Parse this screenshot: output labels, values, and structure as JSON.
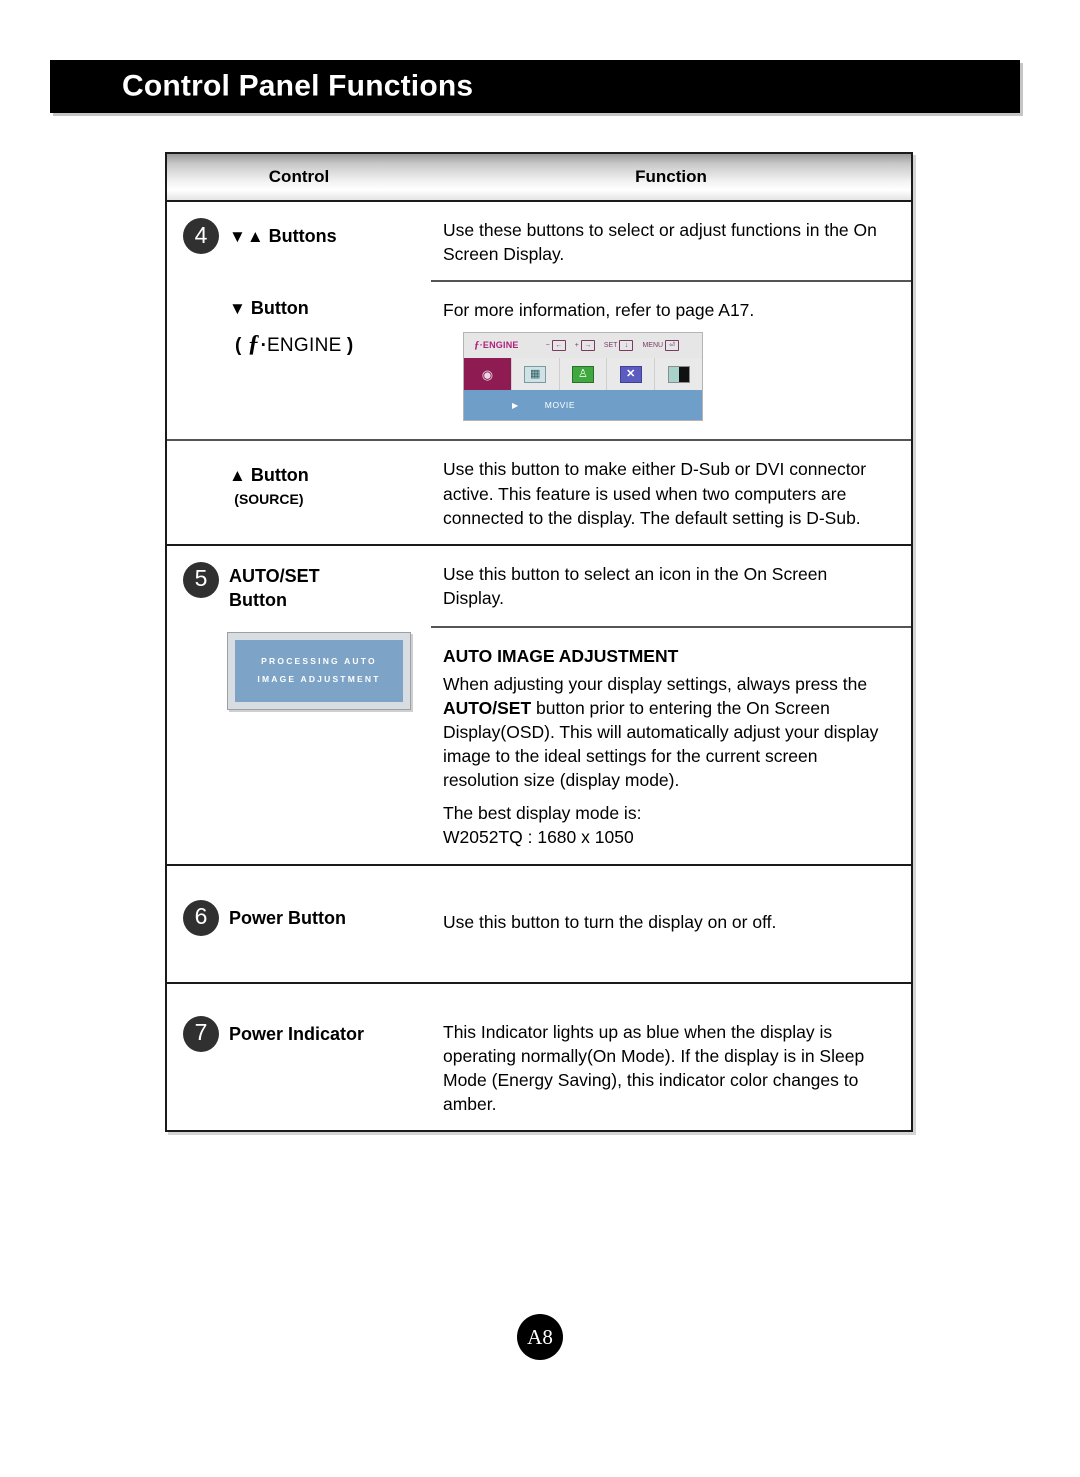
{
  "page": {
    "title": "Control Panel Functions",
    "page_number": "A8"
  },
  "table": {
    "headers": {
      "control": "Control",
      "function": "Function"
    },
    "rows": [
      {
        "number": "4",
        "blocks": [
          {
            "control_arrows": "▼▲",
            "control_label": "Buttons",
            "function_text": "Use these buttons to select or adjust functions in the On Screen Display."
          },
          {
            "control_arrows": "▼",
            "control_label": "Button",
            "control_sublabel_open": "(",
            "control_sublabel_f": "ƒ",
            "control_sublabel_dot": "·",
            "control_sublabel_name": "ENGINE",
            "control_sublabel_close": ")",
            "function_text": "For more information, refer to page A17.",
            "osd": {
              "brand_f": "ƒ",
              "brand_dot": "·",
              "brand_name": "ENGINE",
              "keys": [
                {
                  "prefix": "−",
                  "cap": "←"
                },
                {
                  "prefix": "+",
                  "cap": "→"
                },
                {
                  "prefix": "SET",
                  "cap": "↓"
                },
                {
                  "prefix": "MENU",
                  "cap": "⏎"
                }
              ],
              "icons": [
                {
                  "name": "movie-film-icon",
                  "glyph": "◉",
                  "selected": true
                },
                {
                  "name": "internet-globe-icon",
                  "glyph": "▦",
                  "selected": false
                },
                {
                  "name": "user-person-icon",
                  "glyph": "♙",
                  "selected": false
                },
                {
                  "name": "demo-x-icon",
                  "glyph": "✕",
                  "selected": false
                },
                {
                  "name": "contrast-icon",
                  "glyph": "",
                  "selected": false
                }
              ],
              "caret": "▶",
              "mode_label": "MOVIE"
            }
          },
          {
            "control_arrows": "▲",
            "control_label": "Button",
            "control_sublabel": "(SOURCE)",
            "function_text": "Use this button to make either D-Sub or DVI connector active. This feature is used when two computers are connected to the display. The default setting is D-Sub."
          }
        ]
      },
      {
        "number": "5",
        "blocks": [
          {
            "control_label_line1": "AUTO/SET",
            "control_label_line2": "Button",
            "function_text": "Use this button to select an icon in the On Screen Display."
          },
          {
            "function_title": "AUTO IMAGE ADJUSTMENT",
            "function_para1_a": "When adjusting your display settings, always press the ",
            "function_para1_bold": "AUTO/SET",
            "function_para1_b": " button prior to entering the On Screen Display(OSD). This will automatically adjust your display image to the ideal settings for the current screen resolution size (display mode).",
            "function_para2_line1": "The best display mode is:",
            "function_para2_line2": "W2052TQ : 1680 x 1050",
            "processing_box": {
              "line1": "PROCESSING AUTO",
              "line2": "IMAGE ADJUSTMENT"
            }
          }
        ]
      },
      {
        "number": "6",
        "blocks": [
          {
            "control_label": "Power Button",
            "function_text": "Use this button to turn the display on or off."
          }
        ]
      },
      {
        "number": "7",
        "blocks": [
          {
            "control_label": "Power Indicator",
            "function_text": "This Indicator lights up as blue when the display is operating normally(On Mode). If the display is in Sleep Mode (Energy Saving), this indicator color changes to amber."
          }
        ]
      }
    ]
  },
  "colors": {
    "banner_bg": "#000000",
    "osd_accent": "#8e1b52",
    "osd_bottom": "#6f9fc8",
    "processing_bg": "#7da3c6",
    "marker_circle": "#303030"
  }
}
